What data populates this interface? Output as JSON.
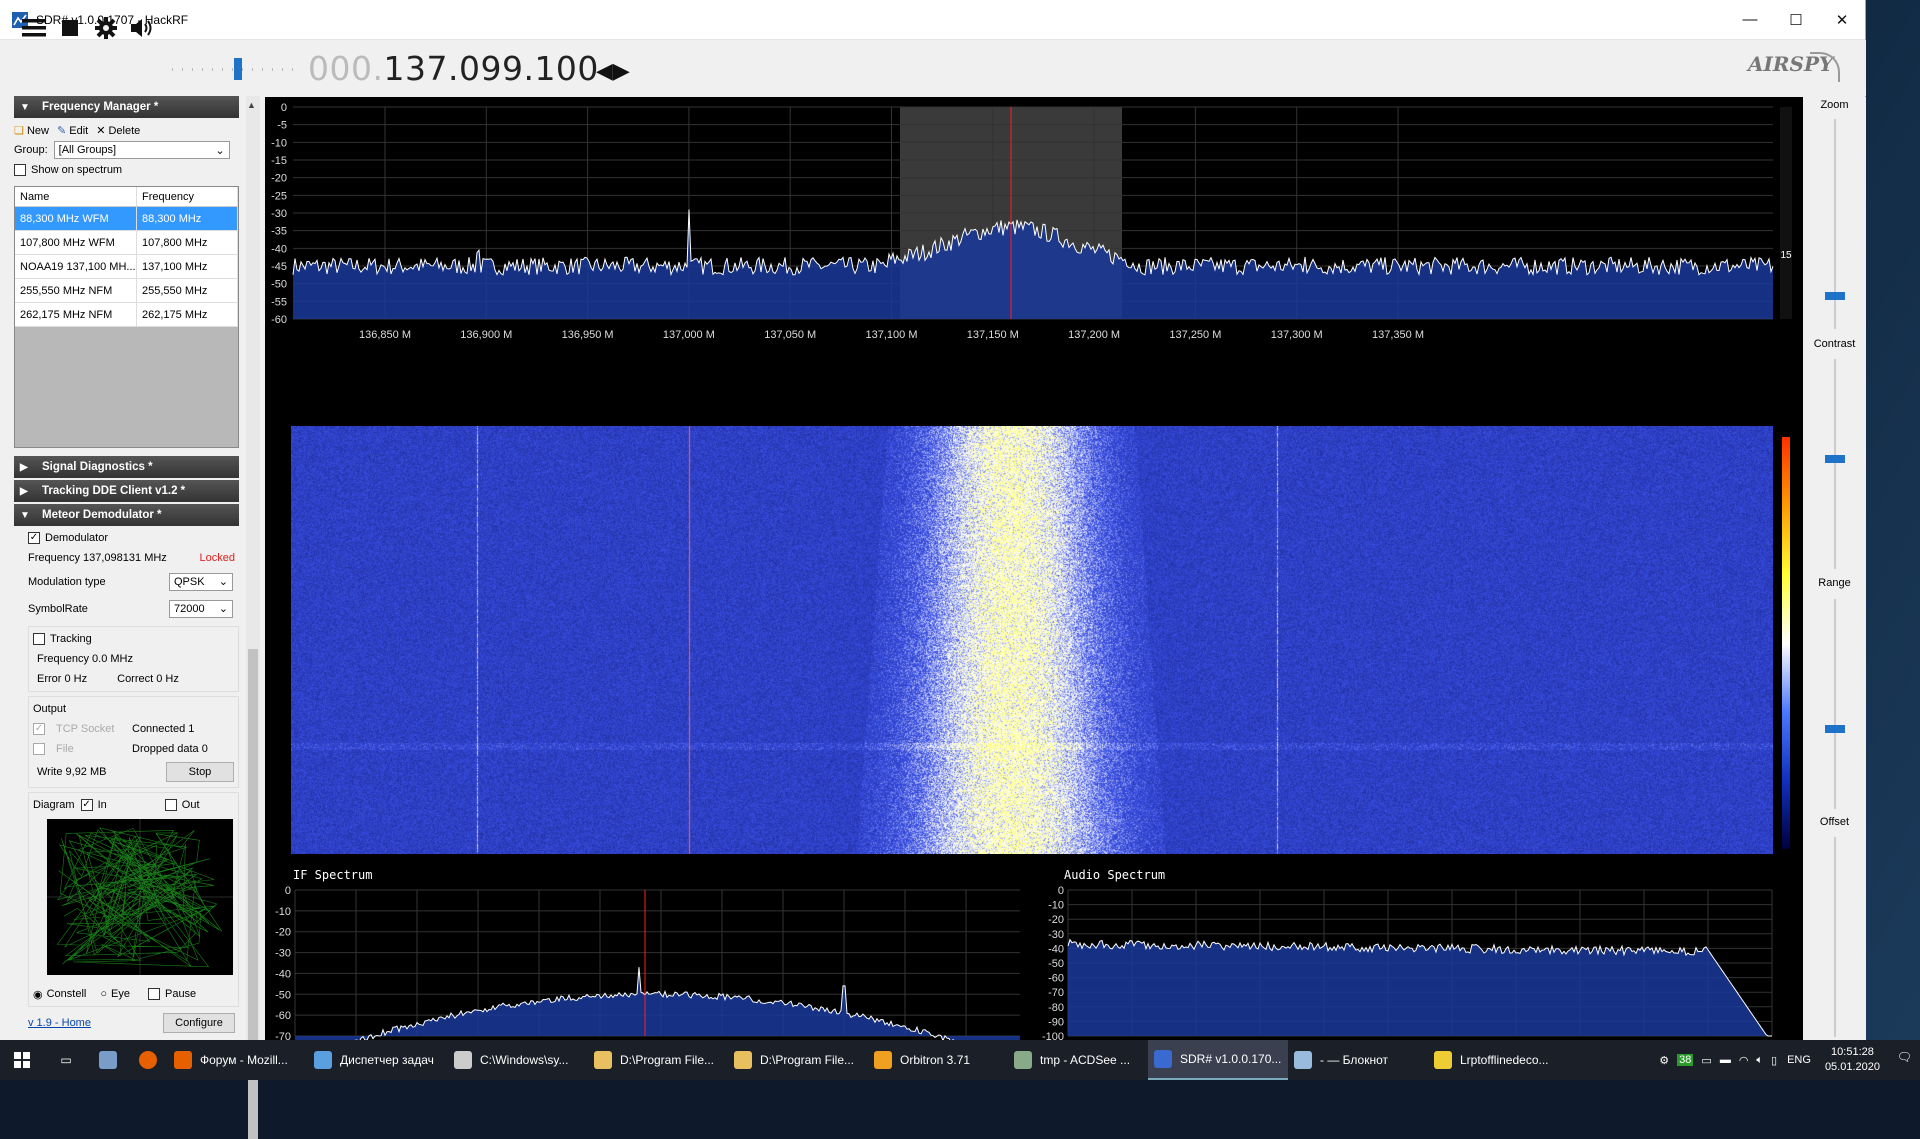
{
  "window": {
    "title": "SDR# v1.0.0.1707 - HackRF",
    "minimize": "—",
    "maximize": "☐",
    "close": "✕"
  },
  "toolbar": {
    "freq_dim": "000.",
    "freq_main": "137.099.100",
    "logo": "AIRSPY"
  },
  "left": {
    "freq_manager": {
      "header": "Frequency Manager *",
      "new": "New",
      "edit": "Edit",
      "delete": "Delete",
      "group_label": "Group:",
      "group_value": "[All Groups]",
      "show_on_spectrum": "Show on spectrum",
      "col_name": "Name",
      "col_freq": "Frequency",
      "rows": [
        {
          "name": "88,300 MHz WFM",
          "freq": "88,300 MHz"
        },
        {
          "name": "107,800 MHz WFM",
          "freq": "107,800 MHz"
        },
        {
          "name": "NOAA19 137,100 MH...",
          "freq": "137,100 MHz"
        },
        {
          "name": "255,550 MHz NFM",
          "freq": "255,550 MHz"
        },
        {
          "name": "262,175 MHz NFM",
          "freq": "262,175 MHz"
        }
      ]
    },
    "signal_diag": "Signal Diagnostics *",
    "tracking_dde": "Tracking DDE Client v1.2 *",
    "meteor": {
      "header": "Meteor Demodulator *",
      "demodulator": "Demodulator",
      "frequency": "Frequency 137,098131 MHz",
      "locked": "Locked",
      "mod_label": "Modulation type",
      "mod_value": "QPSK",
      "sym_label": "SymbolRate",
      "sym_value": "72000",
      "tracking": "Tracking",
      "trk_freq": "Frequency 0.0 MHz",
      "error": "Error 0 Hz",
      "correct": "Correct 0 Hz",
      "output": "Output",
      "tcp": "TCP Socket",
      "connected": "Connected 1",
      "file": "File",
      "dropped": "Dropped data 0",
      "write": "Write 9,92 MB",
      "stop": "Stop",
      "diagram": "Diagram",
      "in": "In",
      "out": "Out",
      "constell": "Constell",
      "eye": "Eye",
      "pause": "Pause",
      "home_link": "v 1.9 - Home",
      "configure": "Configure"
    }
  },
  "spectrum": {
    "y_ticks": [
      "0",
      "-5",
      "-10",
      "-15",
      "-20",
      "-25",
      "-30",
      "-35",
      "-40",
      "-45",
      "-50",
      "-55",
      "-60"
    ],
    "x_ticks": [
      "136,850 M",
      "136,900 M",
      "136,950 M",
      "137,000 M",
      "137,050 M",
      "137,100 M",
      "137,150 M",
      "137,200 M",
      "137,250 M",
      "137,300 M",
      "137,350 M"
    ],
    "side_value": "15"
  },
  "if_spectrum": {
    "title": "IF Spectrum",
    "y_ticks": [
      "0",
      "-10",
      "-20",
      "-30",
      "-40",
      "-50",
      "-60",
      "-70"
    ]
  },
  "audio_spectrum": {
    "title": "Audio Spectrum",
    "y_ticks": [
      "0",
      "-10",
      "-20",
      "-30",
      "-40",
      "-50",
      "-60",
      "-70",
      "-80",
      "-90",
      "-100"
    ]
  },
  "right": {
    "zoom": "Zoom",
    "contrast": "Contrast",
    "range": "Range",
    "offset": "Offset"
  },
  "taskbar": {
    "items": [
      {
        "label": "Форум - Mozill..."
      },
      {
        "label": "Диспетчер задач"
      },
      {
        "label": "C:\\Windows\\sy..."
      },
      {
        "label": "D:\\Program File..."
      },
      {
        "label": "D:\\Program File..."
      },
      {
        "label": "Orbitron 3.71"
      },
      {
        "label": "tmp - ACDSee ..."
      },
      {
        "label": "SDR# v1.0.0.170..."
      },
      {
        "label": "- — Блокнот"
      },
      {
        "label": "Lrptofflinedeco..."
      }
    ],
    "lang": "ENG",
    "time": "10:51:28",
    "date": "05.01.2020",
    "badge": "38"
  },
  "colors": {
    "accent": "#1e73c8",
    "selection": "#3399ff",
    "spectrum_fill": "#1a3a9a",
    "center_line": "#ff2020"
  }
}
